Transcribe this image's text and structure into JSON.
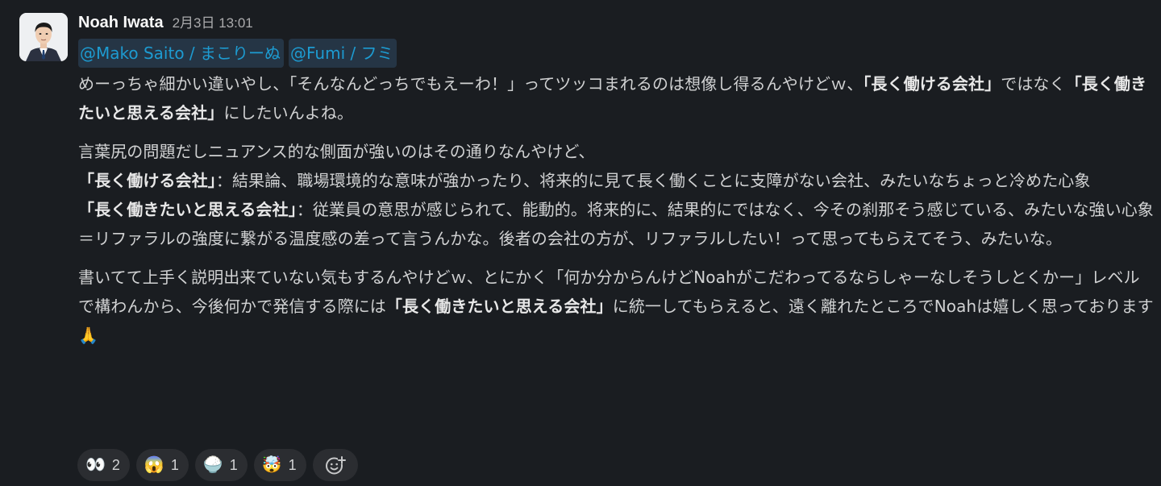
{
  "message": {
    "sender": "Noah Iwata",
    "timestamp": "2月3日 13:01",
    "mentions": [
      "@Mako Saito / まこりーぬ",
      "@Fumi / フミ"
    ],
    "paragraphs": {
      "p1_a": "めーっちゃ細かい違いやし、「そんなんどっちでもえーわ！」ってツッコまれるのは想像し得るんやけどｗ、",
      "p1_b": "「長く働ける会社」",
      "p1_c": "ではなく",
      "p1_d": "「長く働きたいと思える会社」",
      "p1_e": "にしたいんよね。",
      "p2_a": "言葉尻の問題だしニュアンス的な側面が強いのはその通りなんやけど、",
      "p2_b": "「長く働ける会社」",
      "p2_c": "：結果論、職場環境的な意味が強かったり、将来的に見て長く働くことに支障がない会社、みたいなちょっと冷めた心象",
      "p2_d": "「長く働きたいと思える会社」",
      "p2_e": "：従業員の意思が感じられて、能動的。将来的に、結果的にではなく、今その刹那そう感じている、みたいな強い心象",
      "p2_f": "＝リファラルの強度に繋がる温度感の差って言うんかな。後者の会社の方が、リファラルしたい！って思ってもらえてそう、みたいな。",
      "p3_a": "書いてて上手く説明出来ていない気もするんやけどｗ、とにかく「何か分からんけどNoahがこだわってるならしゃーなしそうしとくかー」レベルで構わんから、今後何かで発信する際には",
      "p3_b": "「長く働きたいと思える会社」",
      "p3_c": "に統一してもらえると、遠く離れたところでNoahは嬉しく思っております",
      "p3_emoji": "🙏"
    }
  },
  "reactions": [
    {
      "emoji": "👀",
      "count": "2",
      "icon": "eyes-icon"
    },
    {
      "emoji": "😱",
      "count": "1",
      "icon": "scream-icon"
    },
    {
      "emoji": "🍚",
      "count": "1",
      "icon": "rice-icon"
    },
    {
      "emoji": "🤯",
      "count": "1",
      "icon": "mind-blown-icon"
    }
  ],
  "add_reaction_icon": "add-reaction-icon",
  "colors": {
    "background": "#1a1d21",
    "mention_text": "#1d9bd1",
    "mention_bg": "#253545",
    "reaction_bg": "#2b2d31"
  }
}
